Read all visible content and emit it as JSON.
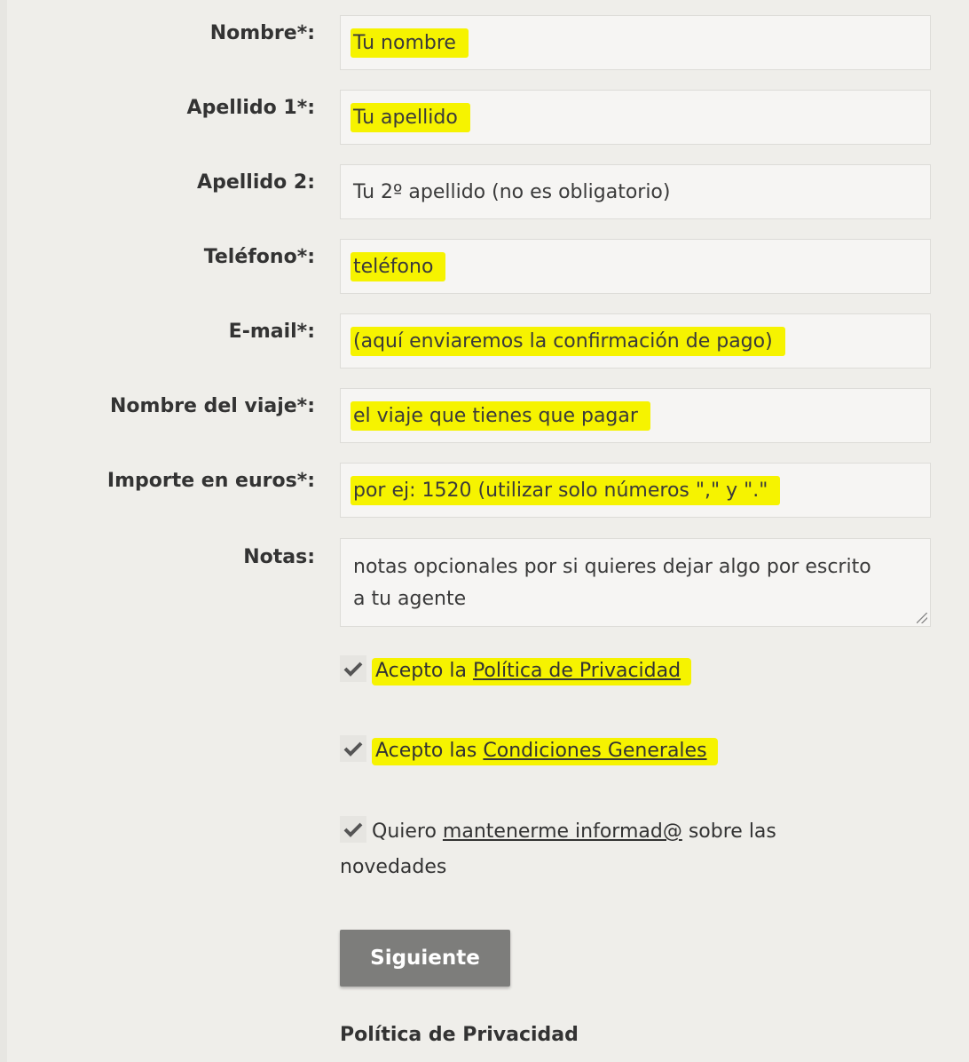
{
  "form": {
    "fields": [
      {
        "label": "Nombre*:",
        "placeholder": "Tu nombre"
      },
      {
        "label": "Apellido 1*:",
        "placeholder": "Tu apellido"
      },
      {
        "label": "Apellido 2:",
        "placeholder": "Tu 2º apellido (no es obligatorio)"
      },
      {
        "label": "Teléfono*:",
        "placeholder": "teléfono"
      },
      {
        "label": "E-mail*:",
        "placeholder": "(aquí enviaremos la confirmación de pago)"
      },
      {
        "label": "Nombre del viaje*:",
        "placeholder": "el viaje que tienes que pagar"
      },
      {
        "label": "Importe en euros*:",
        "placeholder": "por ej: 1520 (utilizar solo números \",\" y \".\""
      }
    ],
    "notes": {
      "label": "Notas:",
      "placeholder": "notas opcionales por si quieres dejar algo por escrito a tu agente"
    },
    "checkboxes": [
      {
        "prefix": "Acepto la ",
        "link": "Política de Privacidad",
        "suffix": "",
        "checked": true
      },
      {
        "prefix": "Acepto las ",
        "link": "Condiciones Generales",
        "suffix": "",
        "checked": true
      },
      {
        "prefix": "Quiero ",
        "link": "mantenerme informad@",
        "suffix": " sobre las",
        "line2": "novedades",
        "checked": true
      }
    ],
    "submit_label": "Siguiente",
    "footer_title": "Política de Privacidad"
  },
  "colors": {
    "background": "#efeeea",
    "highlight": "#f6f300",
    "button": "#7d7d7b"
  }
}
